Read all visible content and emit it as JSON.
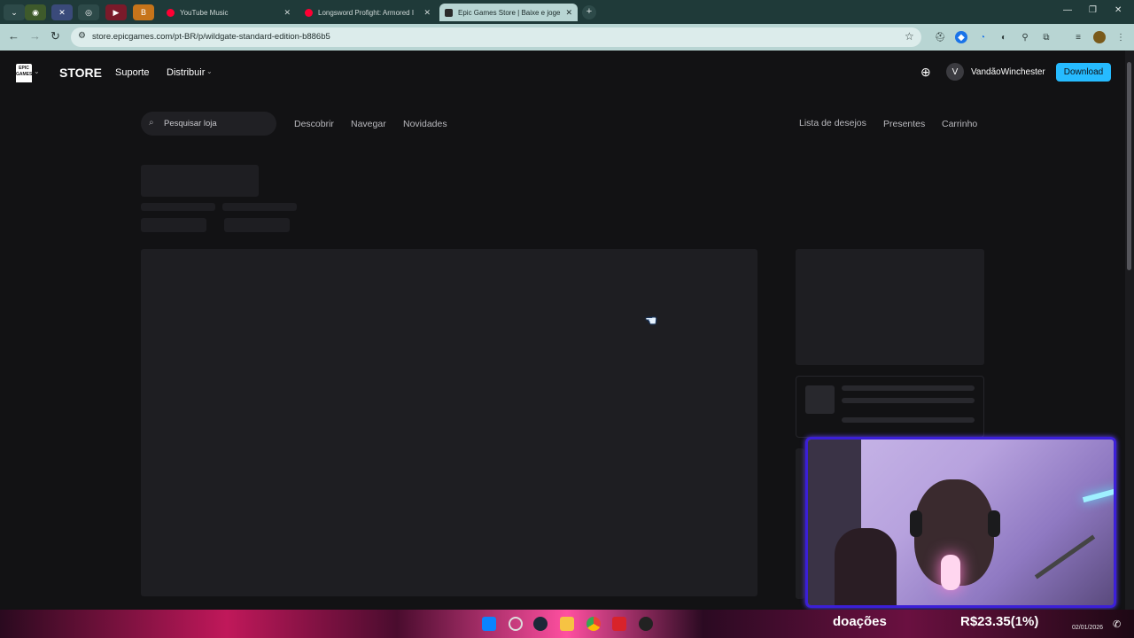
{
  "browser": {
    "tabs": [
      {
        "label": "YouTube Music",
        "favicon_color": "#ff0033"
      },
      {
        "label": "Longsword Profight: Armored I",
        "favicon_color": "#ff0033"
      },
      {
        "label": "Epic Games Store | Baixe e joge",
        "favicon_color": "#2a2a2a"
      }
    ],
    "new_tab": "+",
    "url": "store.epicgames.com/pt-BR/p/wildgate-standard-edition-b886b5"
  },
  "epic": {
    "logo_text": "EPIC GAMES",
    "store": "STORE",
    "nav": [
      "Suporte",
      "Distribuir"
    ],
    "account_initial": "V",
    "username": "VandãoWinchester",
    "download": "Download",
    "search_placeholder": "Pesquisar loja",
    "subnav_left": [
      "Descobrir",
      "Navegar",
      "Novidades"
    ],
    "subnav_right": [
      "Lista de desejos",
      "Presentes",
      "Carrinho"
    ]
  },
  "overlay": {
    "donations_label": "doações",
    "donations_amount": "R$23.35(1%)",
    "clock": "02/01/2026"
  },
  "colors": {
    "accent": "#26bbff",
    "page_bg": "#121214",
    "skeleton": "#1e1e22"
  }
}
